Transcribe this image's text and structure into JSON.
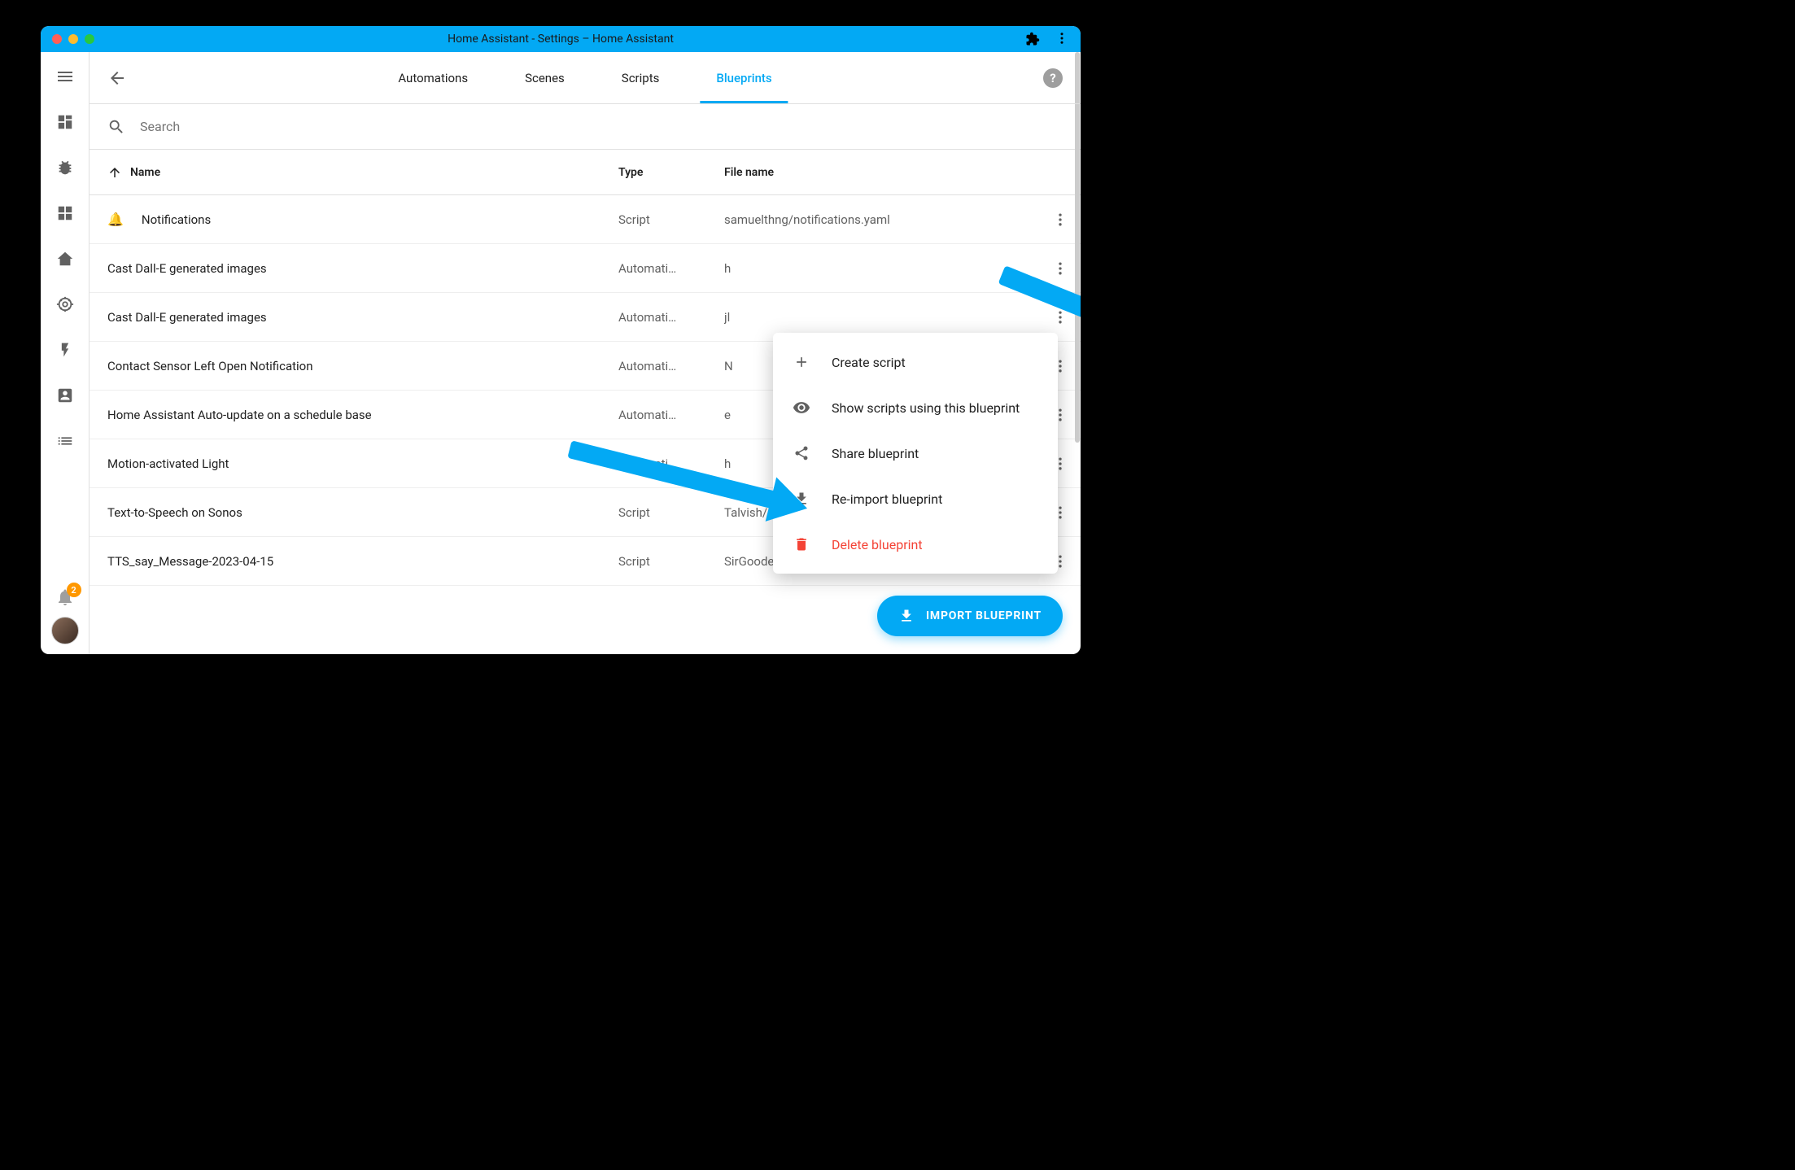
{
  "window": {
    "title": "Home Assistant - Settings – Home Assistant"
  },
  "tabs": {
    "automations": "Automations",
    "scenes": "Scenes",
    "scripts": "Scripts",
    "blueprints": "Blueprints"
  },
  "search": {
    "placeholder": "Search"
  },
  "header": {
    "name": "Name",
    "type": "Type",
    "file": "File name"
  },
  "rows": [
    {
      "icon": "🔔",
      "name": "Notifications",
      "type": "Script",
      "file": "samuelthng/notifications.yaml"
    },
    {
      "icon": "",
      "name": "Cast Dall-E generated images",
      "type": "Automati…",
      "file": "h"
    },
    {
      "icon": "",
      "name": "Cast Dall-E generated images",
      "type": "Automati…",
      "file": "jl"
    },
    {
      "icon": "",
      "name": "Contact Sensor Left Open Notification",
      "type": "Automati…",
      "file": "N"
    },
    {
      "icon": "",
      "name": "Home Assistant Auto-update on a schedule base",
      "type": "Automati…",
      "file": "e"
    },
    {
      "icon": "",
      "name": "Motion-activated Light",
      "type": "Automati…",
      "file": "h"
    },
    {
      "icon": "",
      "name": "Text-to-Speech on Sonos",
      "type": "Script",
      "file": "Talvish/sonos_say.yaml"
    },
    {
      "icon": "",
      "name": "TTS_say_Message-2023-04-15",
      "type": "Script",
      "file": "SirGoodenough/tts_All_Message_…"
    }
  ],
  "menu": {
    "create": "Create script",
    "show": "Show scripts using this blueprint",
    "share": "Share blueprint",
    "reimport": "Re-import blueprint",
    "delete": "Delete blueprint"
  },
  "fab": {
    "label": "IMPORT BLUEPRINT"
  },
  "notifications": {
    "count": "2"
  }
}
